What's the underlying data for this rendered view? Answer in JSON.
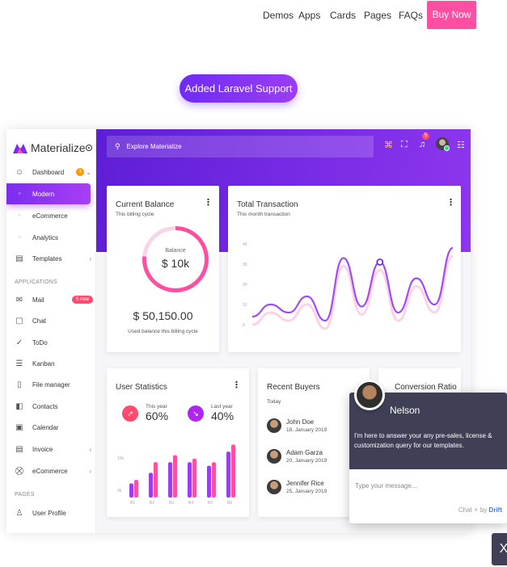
{
  "nav": {
    "links": [
      "Demos",
      "Apps",
      "Cards",
      "Pages",
      "FAQs"
    ],
    "buy_now": "Buy Now"
  },
  "banner": {
    "text": "Added Laravel Support 😊"
  },
  "app": {
    "brand": "Materialize",
    "search_placeholder": "Explore Materialize",
    "notification_count": "5",
    "sidebar": {
      "dashboard": "Dashboard",
      "dashboard_badge": "3",
      "modern": "Modern",
      "ecommerce": "eCommerce",
      "analytics": "Analytics",
      "templates": "Templates",
      "section_applications": "APPLICATIONS",
      "mail": "Mail",
      "mail_badge": "5 new",
      "chat": "Chat",
      "todo": "ToDo",
      "kanban": "Kanban",
      "file_manager": "File manager",
      "contacts": "Contacts",
      "calendar": "Calendar",
      "invoice": "Invoice",
      "ecommerce_app": "eCommerce",
      "section_pages": "PAGES",
      "user_profile": "User Profile"
    },
    "current_balance": {
      "title": "Current Balance",
      "subtitle": "This billing cycle",
      "ring_label": "Balance",
      "ring_value": "$ 10k",
      "amount": "$ 50,150.00",
      "note": "Used balance this billing cycle"
    },
    "total_transaction": {
      "title": "Total Transaction",
      "subtitle": "This month transaction"
    },
    "user_statistics": {
      "title": "User Statistics",
      "this_year_label": "This year",
      "this_year_value": "60%",
      "last_year_label": "Last year",
      "last_year_value": "40%"
    },
    "recent_buyers": {
      "title": "Recent Buyers",
      "subtitle": "Today",
      "buyers": [
        {
          "name": "John Doe",
          "date": "18, January 2019"
        },
        {
          "name": "Adam Garza",
          "date": "20, January 2019"
        },
        {
          "name": "Jennifer Rice",
          "date": "25, January 2019"
        }
      ]
    },
    "conversion_ratio": {
      "title": "Conversion Ratio"
    }
  },
  "chart_data": [
    {
      "type": "line",
      "title": "Total Transaction",
      "y_ticks": [
        "40",
        "30",
        "20",
        "10",
        "0"
      ],
      "x": [
        0,
        1,
        2,
        3,
        4,
        5,
        6,
        7,
        8,
        9,
        10,
        11
      ],
      "values": [
        4,
        10,
        6,
        14,
        2,
        33,
        9,
        31,
        6,
        23,
        10,
        38
      ],
      "ylim": [
        0,
        40
      ],
      "highlight_index": 7,
      "color": "#a04cf5"
    },
    {
      "type": "bar",
      "title": "User Statistics",
      "categories": [
        "B1",
        "B2",
        "B3",
        "B4",
        "B5",
        "B6"
      ],
      "y_ticks": [
        "10k",
        "0k"
      ],
      "series": [
        {
          "values": [
            4,
            7,
            10,
            10,
            9,
            13
          ],
          "color": "#9b3df5"
        },
        {
          "values": [
            5,
            10,
            12,
            11,
            10,
            15
          ],
          "color": "#ff4fa3"
        }
      ],
      "ylim": [
        0,
        16
      ]
    }
  ],
  "chat": {
    "agent_name": "Nelson",
    "message": "I'm here to answer your any pre-sales, license & customization query for our templates.",
    "input_placeholder": "Type your message...",
    "brand_prefix": "Chat ⚡ by",
    "brand_name": "Drift",
    "close_label": "X"
  }
}
